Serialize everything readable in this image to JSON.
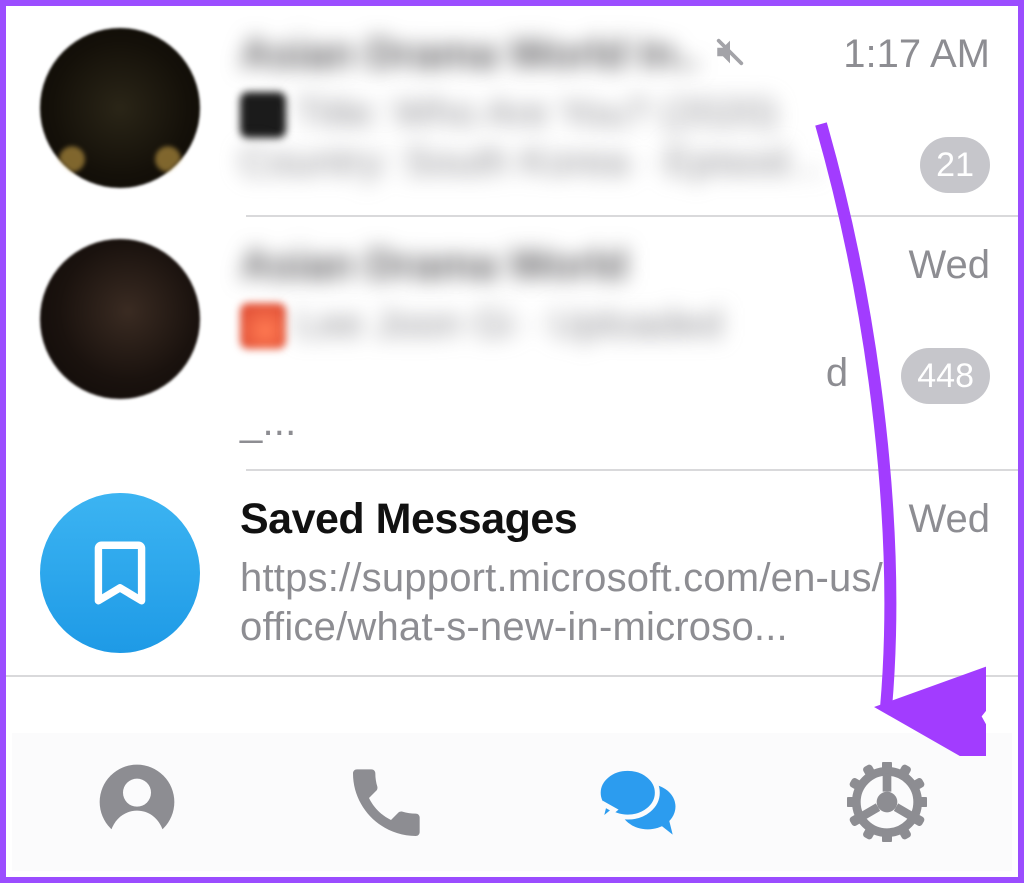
{
  "chats": [
    {
      "title": "Asian Drama World In..",
      "muted": true,
      "time": "1:17 AM",
      "preview_line1": "Title: Who Are You? (2020)",
      "preview_line2": "Country: South Korea · Episod...",
      "badge": "21"
    },
    {
      "title": "Asian Drama World",
      "muted": false,
      "time": "Wed",
      "preview_line1": "Lee Joon Gi · Uploaded",
      "preview_line2": "d_...",
      "badge": "448"
    },
    {
      "title": "Saved Messages",
      "muted": false,
      "time": "Wed",
      "preview": "https://support.microsoft.com/en-us/office/what-s-new-in-microso...",
      "badge": null
    }
  ],
  "tabs": {
    "contacts": "Contacts",
    "calls": "Calls",
    "chats": "Chats",
    "settings": "Settings"
  }
}
